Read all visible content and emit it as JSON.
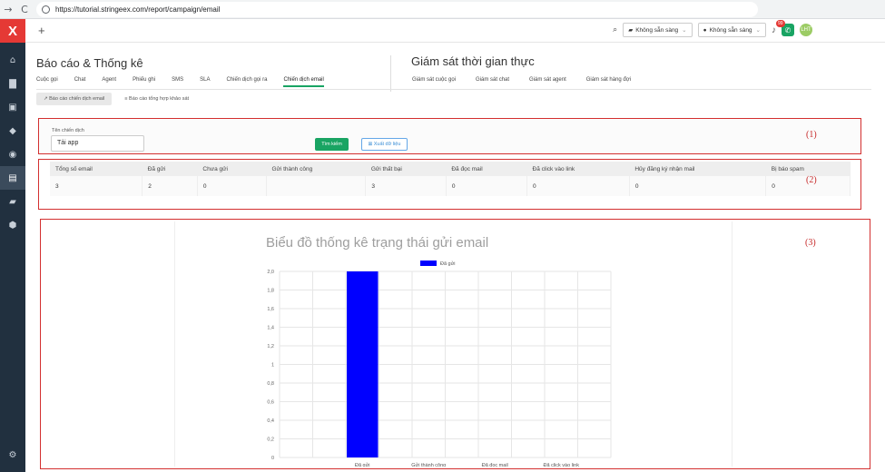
{
  "browser": {
    "back": "→",
    "reload": "C",
    "url": "https://tutorial.stringeex.com/report/campaign/email"
  },
  "sidebar": {
    "logo": "X",
    "icons": [
      "home-icon",
      "folder-icon",
      "contact-card-icon",
      "tag-icon",
      "target-icon",
      "report-icon",
      "chat-icon",
      "box-icon"
    ],
    "settings_icon": "gear-icon"
  },
  "topbar": {
    "plus": "+",
    "status_one": "Không sẵn sàng",
    "status_two": "Không sẵn sàng",
    "notif_count": "99",
    "avatar_initials": "LHT"
  },
  "page": {
    "title": "Báo cáo & Thống kê",
    "realtime_title": "Giám sát thời gian thực",
    "tabs": [
      "Cuộc gọi",
      "Chat",
      "Agent",
      "Phiếu ghi",
      "SMS",
      "SLA",
      "Chiến dịch gọi ra",
      "Chiến dịch email"
    ],
    "active_tab": "Chiến dịch email",
    "realtime_tabs": [
      "Giám sát cuộc gọi",
      "Giám sát chat",
      "Giám sát agent",
      "Giám sát hàng đợi"
    ],
    "subtabs": [
      "Báo cáo chiến dịch email",
      "Báo cáo tổng hợp khảo sát"
    ]
  },
  "filter": {
    "label": "Tên chiến dịch",
    "value": "Tải app",
    "search_label": "Tìm kiếm",
    "export_label": "Xuất dữ liệu",
    "marker": "(1)"
  },
  "stats": {
    "marker": "(2)",
    "headers": [
      "Tổng số email",
      "Đã gửi",
      "Chưa gửi",
      "Gửi thành công",
      "Gửi thất bại",
      "Đã đọc mail",
      "Đã click vào link",
      "Hủy đăng ký nhận mail",
      "Bị báo spam"
    ],
    "values": [
      "3",
      "2",
      "0",
      "",
      "3",
      "0",
      "0",
      "0",
      "0"
    ]
  },
  "chart_section": {
    "marker": "(3)"
  },
  "chart_data": {
    "type": "bar",
    "title": "Biểu đồ thống kê trạng thái gửi email",
    "legend": [
      "Đã gửi"
    ],
    "legend_position": "top",
    "categories": [
      "",
      "",
      "Đã gửi",
      "",
      "Gửi thành công",
      "",
      "Đã đọc mail",
      "",
      "Đã click vào link",
      ""
    ],
    "series": [
      {
        "name": "Đã gửi",
        "values": [
          0,
          0,
          2,
          0,
          0,
          0,
          0,
          0,
          0,
          0
        ]
      }
    ],
    "yticks": [
      "0",
      "0,2",
      "0,4",
      "0,6",
      "0,8",
      "1",
      "1,2",
      "1,4",
      "1,6",
      "1,8",
      "2,0"
    ],
    "ylim": [
      0,
      2
    ],
    "grid": true,
    "bar_color": "#0000ff"
  }
}
